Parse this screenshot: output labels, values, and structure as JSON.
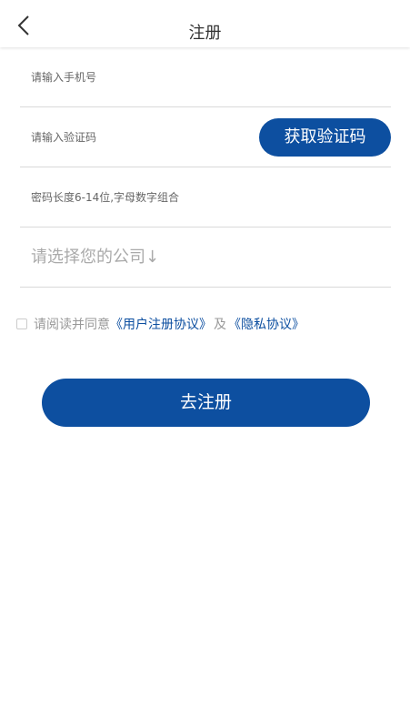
{
  "header": {
    "back_icon": "chevron-left-icon",
    "title": "注册"
  },
  "form": {
    "phone_placeholder": "请输入手机号",
    "code_placeholder": "请输入验证码",
    "get_code_label": "获取验证码",
    "password_placeholder": "密码长度6-14位,字母数字组合",
    "company_placeholder": "请选择您的公司↓"
  },
  "agreement": {
    "prefix": "请阅读并同意",
    "user_agreement": "《用户注册协议》",
    "and": "及",
    "privacy_agreement": "《隐私协议》"
  },
  "submit": {
    "label": "去注册"
  },
  "colors": {
    "primary": "#0d4fa0",
    "divider": "#d9d9d9",
    "muted_text": "#999999"
  }
}
